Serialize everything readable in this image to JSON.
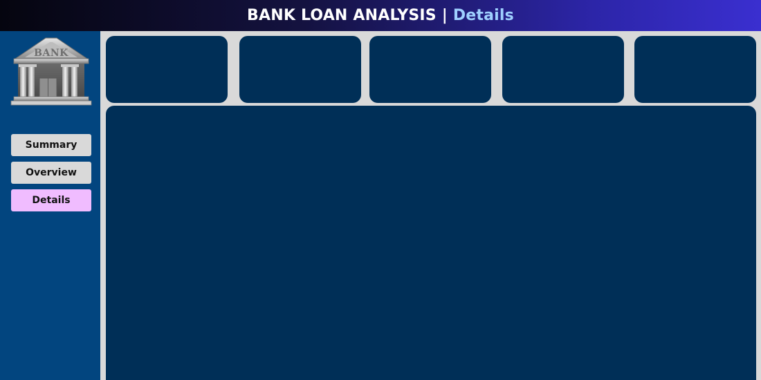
{
  "header": {
    "title_main": "BANK LOAN ANALYSIS",
    "separator": "|",
    "title_page": "Details"
  },
  "logo": {
    "icon": "bank-building-icon",
    "text": "BANK"
  },
  "nav": {
    "items": [
      {
        "label": "Summary",
        "active": false
      },
      {
        "label": "Overview",
        "active": false
      },
      {
        "label": "Details",
        "active": true
      }
    ]
  },
  "colors": {
    "header_gradient_start": "#05050f",
    "header_gradient_end": "#3a2fd0",
    "header_page_text": "#9fd0ff",
    "sidebar": "#02457f",
    "card": "#002f57",
    "canvas": "#d9d9d9",
    "nav_button": "#d9d9d9",
    "nav_button_active": "#f0bcff"
  }
}
